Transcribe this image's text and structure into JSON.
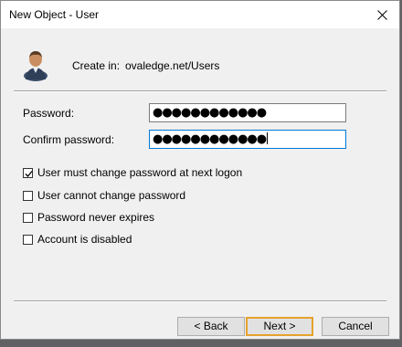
{
  "window": {
    "title": "New Object - User"
  },
  "header": {
    "create_label": "Create in:",
    "create_path": "ovaledge.net/Users"
  },
  "form": {
    "password_label": "Password:",
    "password_mask": "●●●●●●●●●●●●",
    "confirm_label": "Confirm password:",
    "confirm_mask": "●●●●●●●●●●●●"
  },
  "options": [
    {
      "label": "User must change password at next logon",
      "checked": true
    },
    {
      "label": "User cannot change password",
      "checked": false
    },
    {
      "label": "Password never expires",
      "checked": false
    },
    {
      "label": "Account is disabled",
      "checked": false
    }
  ],
  "buttons": {
    "back": "< Back",
    "next": "Next >",
    "cancel": "Cancel"
  },
  "colors": {
    "focus_border": "#0078d7",
    "default_button_border": "#e5a22c"
  }
}
